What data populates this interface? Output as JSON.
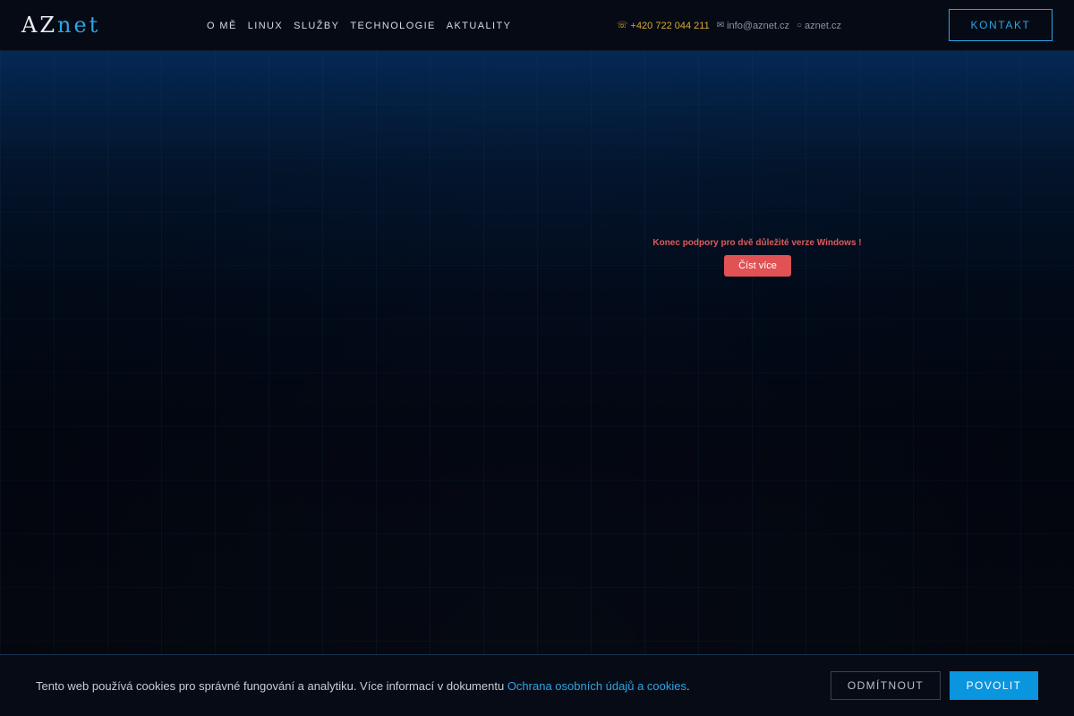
{
  "header": {
    "logo_part1": "AZ",
    "logo_part2": "net",
    "nav": [
      {
        "label": "O MĚ"
      },
      {
        "label": "LINUX"
      },
      {
        "label": "SLUŽBY"
      },
      {
        "label": "TECHNOLOGIE"
      },
      {
        "label": "AKTUALITY"
      }
    ],
    "contacts": {
      "phone": "+420 722 044 211",
      "email": "info@aznet.cz",
      "web": "aznet.cz",
      "phone_icon": "phone-icon",
      "email_icon": "envelope-icon",
      "web_icon": "globe-icon"
    },
    "kontakt_label": "KONTAKT"
  },
  "hero": {
    "notice": "Konec podpory pro dvě důležité verze Windows !",
    "read_more_label": "Číst více"
  },
  "cookie_bar": {
    "text": "Tento web používá cookies pro správné fungování a analytiku. Více informací v dokumentu ",
    "link_label": "Ochrana osobních údajů a cookies",
    "text_end": ".",
    "reject_label": "ODMÍTNOUT",
    "allow_label": "POVOLIT"
  },
  "colors": {
    "accent": "#2aa6e6",
    "phone": "#d9a830",
    "notice": "#e05a57",
    "allow_button": "#0a95df"
  }
}
